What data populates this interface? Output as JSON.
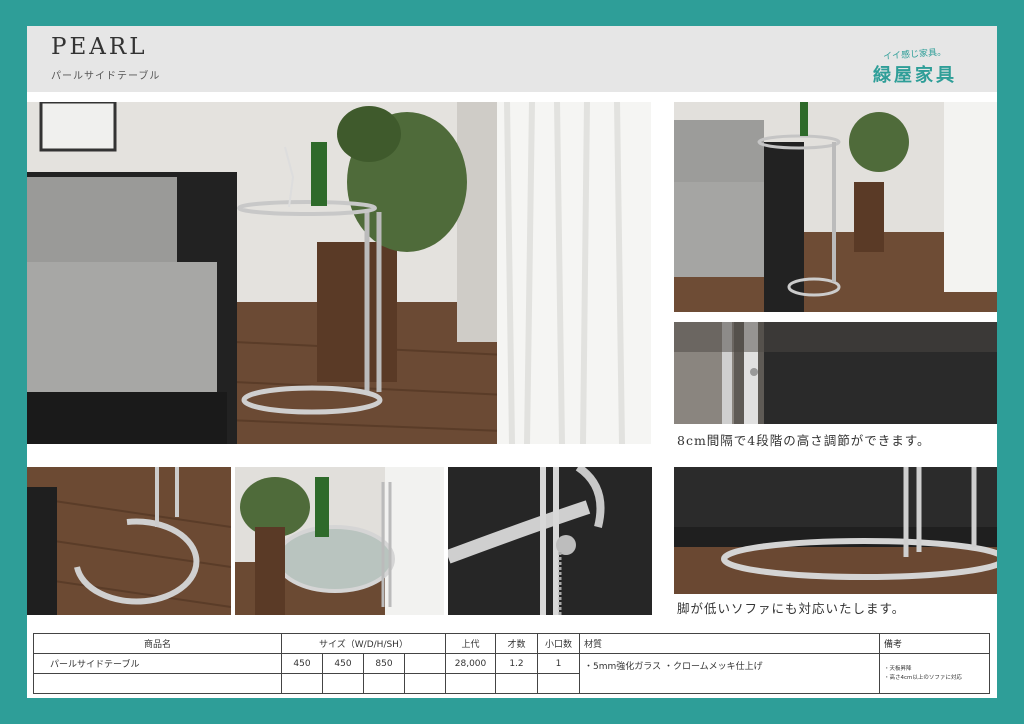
{
  "header": {
    "title": "PEARL",
    "subtitle": "パールサイドテーブル",
    "brand_tagline": "イイ感じ家具。",
    "brand_name": "緑屋家具"
  },
  "captions": {
    "height_adjust": "8cm間隔で4段階の高さ調節ができます。",
    "low_sofa": "脚が低いソファにも対応いたします。"
  },
  "spec_table": {
    "headers": {
      "name": "商品名",
      "size": "サイズ（W/D/H/SH）",
      "price": "上代",
      "volume": "才数",
      "units": "小口数",
      "material": "材質",
      "notes": "備考"
    },
    "row": {
      "name": "パールサイドテーブル",
      "w": "450",
      "d": "450",
      "h": "850",
      "sh": "",
      "price": "28,000",
      "volume": "1.2",
      "units": "1",
      "material": "・5mm強化ガラス ・クロームメッキ仕上げ",
      "note_1": "・天板昇降",
      "note_2": "・高さ4cm以上のソファに対応"
    }
  },
  "colors": {
    "frame": "#2e9e98",
    "header_bg": "#e6e6e6",
    "brand": "#2e9e98"
  }
}
